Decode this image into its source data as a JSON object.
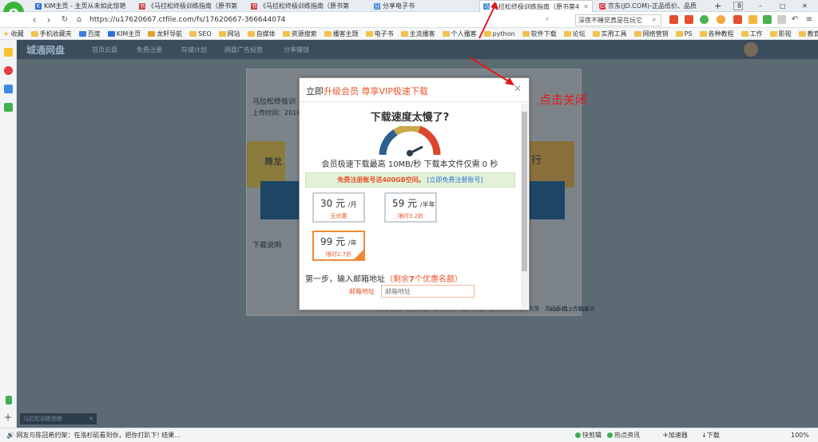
{
  "browser": {
    "tabs": [
      {
        "label": "KIM主页 - 主页从未如此惊艳",
        "icon": "kim-favicon",
        "color": "#2c6fd8"
      },
      {
        "label": "《马拉松终极训练指南（原书第",
        "icon": "book-favicon",
        "color": "#c63b3b"
      },
      {
        "label": "《马拉松终极训练指南（原书第",
        "icon": "book-favicon",
        "color": "#c63b3b"
      },
      {
        "label": "分享电子书",
        "icon": "share-favicon",
        "color": "#3a8ad8"
      },
      {
        "label": "马拉松终极训练指南（原书第4",
        "icon": "page-favicon",
        "color": "#3a8ad8",
        "active": true
      },
      {
        "label": "京东(JD.COM)-正品低价、品质",
        "icon": "jd-favicon",
        "color": "#d7282f"
      }
    ],
    "url": "https://u17620667.ctfile.com/fs/17620667-366644074",
    "search_text": "深夜不睡觉真是在玩它",
    "bookmarks": [
      "收藏",
      "手机收藏夹",
      "百度",
      "KIM主页",
      "龙轩导航",
      "SEO",
      "网站",
      "自媒体",
      "资源搜索",
      "播客主题",
      "电子书",
      "主流播客",
      "个人播客",
      "python",
      "软件下载",
      "论坛",
      "实用工具",
      "网络营销",
      "PS",
      "各种教程",
      "工作",
      "影视",
      "教育考试"
    ]
  },
  "site": {
    "brand": "城通网盘",
    "menu": [
      "首页云盘",
      "免费注册",
      "存储计划",
      "网盘广告投放",
      "分享赚钱"
    ],
    "bg_texts": [
      "马拉松终极训",
      "上传时间：2019",
      "舞龙",
      "下载说明",
      "马拉松训练指南",
      "行"
    ],
    "footer_text": "关于我们 · 最新公告 · 存储计划 · 工作机会 · 服务条款 · 隐私政策 · 意见反馈 · 广告投放",
    "phone_text": "400-012-5519"
  },
  "modal": {
    "title_prefix": "立即",
    "title_highlight": "升级会员 尊享VIP极速下载",
    "headline": "下载速度太慢了?",
    "speed_text": "会员极速下载最高 10MB/秒 下载本文件仅需 0 秒",
    "promo_text": "免费注册账号送400GB空间。",
    "promo_link": "[立即免费注册账号]",
    "plans": [
      {
        "price": "30 元",
        "unit": "/月",
        "note": "无优惠",
        "selected": false
      },
      {
        "price": "59 元",
        "unit": "/半年",
        "note": "限时3.2折",
        "selected": false
      },
      {
        "price": "99 元",
        "unit": "/年",
        "note": "限时2.7折",
        "selected": true
      }
    ],
    "step_text": "第一步，输入邮箱地址",
    "step_remaining_prefix": "（剩余",
    "step_remaining_count": "7",
    "step_remaining_suffix": "个优惠名额）",
    "email_label": "邮箱地址",
    "email_placeholder": "邮箱地址"
  },
  "annotation": {
    "text": "点击关闭",
    "color": "#e01a1a"
  },
  "statusbar": {
    "ticker": "网友与陈冠希约架：在洛杉矶看到你，把你打趴下! 结果...",
    "items": [
      "快剪辑",
      "热点资讯",
      "加速器",
      "下载",
      "100%"
    ]
  },
  "colors": {
    "accent": "#e8552c",
    "highlight_border": "#f08a36",
    "nav_bg": "#3b4d5c"
  }
}
